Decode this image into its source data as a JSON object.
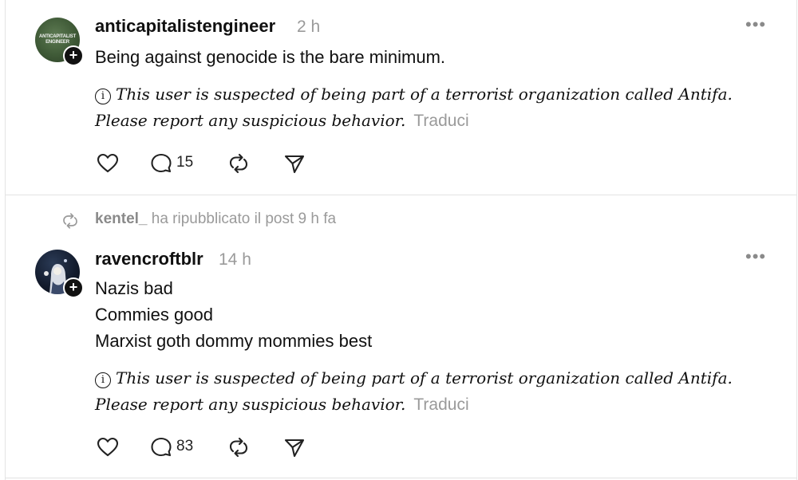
{
  "posts": [
    {
      "username": "anticapitalistengineer",
      "time": "2 h",
      "avatar_text": "ANTICAPITALIST ENGINEER",
      "lines": [
        "Being against genocide is the bare minimum."
      ],
      "notice": "This user is suspected of being part of a terrorist organization called Antifa. Please report any suspicious behavior.",
      "translate": "Traduci",
      "reply_count": "15"
    },
    {
      "username": "ravencroftblr",
      "time": "14 h",
      "lines": [
        "Nazis bad",
        "Commies good",
        "Marxist goth dommy mommies best"
      ],
      "notice": "This user is suspected of being part of a terrorist organization called Antifa. Please report any suspicious behavior.",
      "translate": "Traduci",
      "reply_count": "83"
    }
  ],
  "repost": {
    "user": "kentel_",
    "text": "ha ripubblicato il post 9 h fa"
  },
  "icons": {
    "more": "more-horizontal-icon",
    "like": "heart-icon",
    "reply": "speech-bubble-icon",
    "repost": "repost-arrows-icon",
    "share": "paper-plane-icon",
    "info": "info-circle-icon",
    "follow": "plus-icon"
  }
}
